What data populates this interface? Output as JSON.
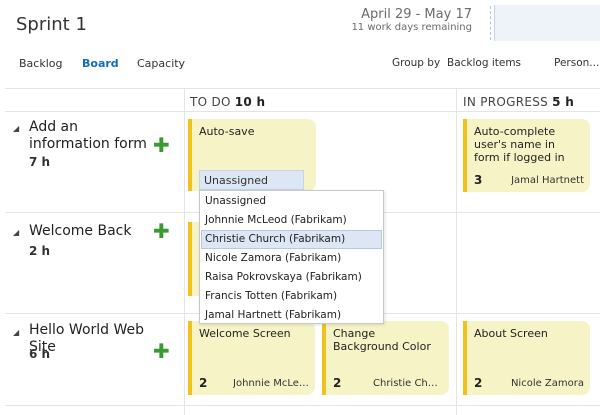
{
  "header": {
    "sprint_title": "Sprint 1",
    "date_range": "April 29 - May 17",
    "work_days": "11 work days remaining"
  },
  "nav": {
    "backlog": "Backlog",
    "board": "Board",
    "capacity": "Capacity",
    "group_by_label": "Group by",
    "group_by_value": "Backlog items",
    "person": "Person..."
  },
  "columns": [
    {
      "name": "TO DO",
      "hours": "10 h"
    },
    {
      "name": "IN PROGRESS",
      "hours": "5 h"
    }
  ],
  "rows": [
    {
      "title": "Add an information form",
      "hours": "7 h"
    },
    {
      "title": "Welcome Back",
      "hours": "2 h"
    },
    {
      "title": "Hello World Web Site",
      "hours": "6 h"
    }
  ],
  "cards": {
    "autosave": {
      "title": "Auto-save",
      "assignee_field": "Unassigned"
    },
    "autocomplete": {
      "title": "Auto-complete user's name in form if logged in",
      "estimate": "3",
      "owner": "Jamal Hartnett"
    },
    "welcome_screen": {
      "title": "Welcome Screen",
      "estimate": "2",
      "owner": "Johnnie McLeod"
    },
    "change_bg": {
      "title": "Change Background Color",
      "estimate": "2",
      "owner": "Christie Church"
    },
    "about_screen": {
      "title": "About Screen",
      "estimate": "2",
      "owner": "Nicole Zamora"
    }
  },
  "dropdown": {
    "options": [
      "Unassigned",
      "Johnnie McLeod (Fabrikam)",
      "Christie Church (Fabrikam)",
      "Nicole Zamora (Fabrikam)",
      "Raisa Pokrovskaya (Fabrikam)",
      "Francis Totten (Fabrikam)",
      "Jamal Hartnett (Fabrikam)"
    ],
    "highlighted": "Christie Church (Fabrikam)"
  },
  "colors": {
    "accent": "#106ebe",
    "card_bg": "#f6f4c7",
    "card_bar": "#f1c21b",
    "add_green": "#3a9b32",
    "highlight": "#dce6f4"
  },
  "icons": {
    "expand": "expand-triangle-icon",
    "add": "plus-icon"
  }
}
